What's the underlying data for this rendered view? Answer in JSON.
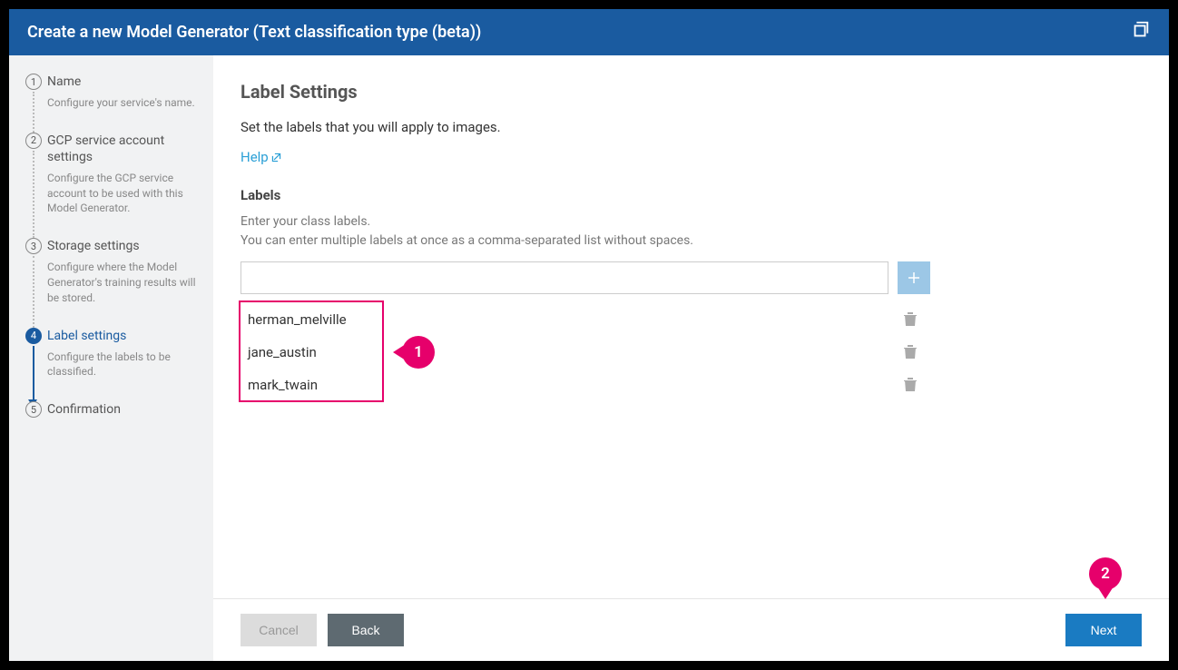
{
  "header": {
    "title": "Create a new Model Generator (Text classification type (beta))"
  },
  "sidebar": {
    "steps": [
      {
        "num": "1",
        "title": "Name",
        "desc": "Configure your service's name."
      },
      {
        "num": "2",
        "title": "GCP service account settings",
        "desc": "Configure the GCP service account to be used with this Model Generator."
      },
      {
        "num": "3",
        "title": "Storage settings",
        "desc": "Configure where the Model Generator's training results will be stored."
      },
      {
        "num": "4",
        "title": "Label settings",
        "desc": "Configure the labels to be classified."
      },
      {
        "num": "5",
        "title": "Confirmation",
        "desc": ""
      }
    ]
  },
  "main": {
    "heading": "Label Settings",
    "subtitle": "Set the labels that you will apply to images.",
    "help": "Help",
    "labels_title": "Labels",
    "hint1": "Enter your class labels.",
    "hint2": "You can enter multiple labels at once as a comma-separated list without spaces.",
    "input_placeholder": "",
    "labels": [
      {
        "name": "herman_melville"
      },
      {
        "name": "jane_austin"
      },
      {
        "name": "mark_twain"
      }
    ]
  },
  "callouts": {
    "c1": "1",
    "c2": "2"
  },
  "footer": {
    "cancel": "Cancel",
    "back": "Back",
    "next": "Next"
  }
}
